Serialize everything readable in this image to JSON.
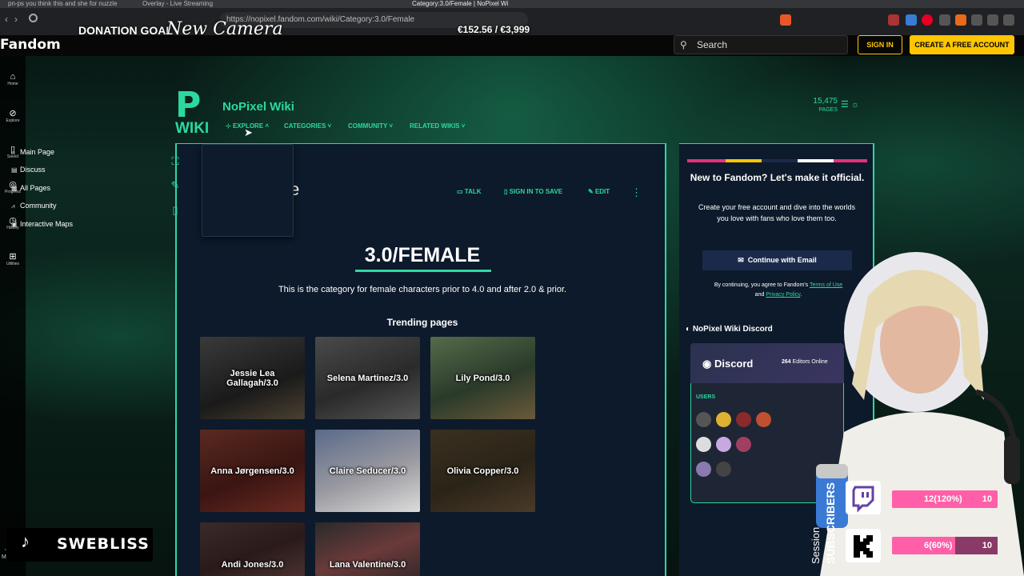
{
  "browser": {
    "tabs": [
      "pn-ps you think this and she for nuzzle",
      "Overlay - Live Streaming",
      "Category:3.0/Female | NoPixel Wiki"
    ],
    "url": "https://nopixel.fandom.com/wiki/Category:3.0/Female"
  },
  "overlay": {
    "donation_label": "DONATION GOAL",
    "donation_script": "New Camera",
    "donation_amount": "€152.56 / €3,999",
    "tiktok_name": "SWEBLISS",
    "session_label_1": "Session",
    "session_label_2": "SUBSCRIBERS",
    "bars": [
      {
        "text": "12(120%)",
        "goal": "10",
        "fill": 1.0
      },
      {
        "text": "6(60%)",
        "goal": "10",
        "fill": 0.6
      }
    ]
  },
  "fandom": {
    "logo": "Fandom",
    "search_placeholder": "Search",
    "sign_in": "SIGN IN",
    "create_account": "CREATE A FREE ACCOUNT",
    "rail": [
      {
        "icon": "home-icon",
        "label": "Home"
      },
      {
        "icon": "explore-icon",
        "label": "Explore"
      },
      {
        "icon": "bookmark-icon",
        "label": "Saved"
      },
      {
        "icon": "progress-icon",
        "label": "Progress"
      },
      {
        "icon": "history-icon",
        "label": "History"
      },
      {
        "icon": "utilities-icon",
        "label": "Utilities"
      },
      {
        "icon": "more-icon",
        "label": "More"
      }
    ]
  },
  "wiki": {
    "logo_text": "WIKI",
    "name": "NoPixel Wiki",
    "nav": [
      "EXPLORE",
      "CATEGORIES",
      "COMMUNITY",
      "RELATED WIKIS"
    ],
    "page_count": "15,475",
    "page_count_label": "PAGES",
    "dropdown": [
      {
        "icon": "home-icon",
        "label": "Main Page"
      },
      {
        "icon": "discuss-icon",
        "label": "Discuss"
      },
      {
        "icon": "pages-icon",
        "label": "All Pages"
      },
      {
        "icon": "community-icon",
        "label": "Community"
      },
      {
        "icon": "map-icon",
        "label": "Interactive Maps"
      }
    ]
  },
  "page": {
    "title_partial": "e",
    "actions": {
      "talk": "TALK",
      "save": "SIGN IN TO SAVE",
      "edit": "EDIT"
    },
    "heading": "3.0/FEMALE",
    "description": "This is the category for female characters prior to 4.0 and after 2.0 & prior.",
    "trending_title": "Trending pages",
    "trending": [
      {
        "label": "Jessie Lea Gallagah/3.0"
      },
      {
        "label": "Selena Martinez/3.0"
      },
      {
        "label": "Lily Pond/3.0"
      },
      {
        "label": "Anna Jørgensen/3.0"
      },
      {
        "label": "Claire Seducer/3.0"
      },
      {
        "label": "Olivia Copper/3.0"
      },
      {
        "label": "Andi Jones/3.0"
      },
      {
        "label": "Lana Valentine/3.0"
      }
    ]
  },
  "promo": {
    "heading": "New to Fandom? Let's make it official.",
    "body": "Create your free account and dive into the worlds you love with fans who love them too.",
    "button": "Continue with Email",
    "terms_prefix": "By continuing, you agree to Fandom's",
    "terms_link": "Terms of Use",
    "terms_and": "and",
    "privacy_link": "Privacy Policy",
    "terms_end": "."
  },
  "discord": {
    "title": "NoPixel Wiki Discord",
    "brand": "Discord",
    "online_count": "264",
    "online_label": "Editors Online",
    "users_label": "USERS"
  },
  "colors": {
    "accent": "#2bd99f",
    "fandom_yellow": "#ffc500",
    "subs_pink": "#ff5fa8"
  }
}
